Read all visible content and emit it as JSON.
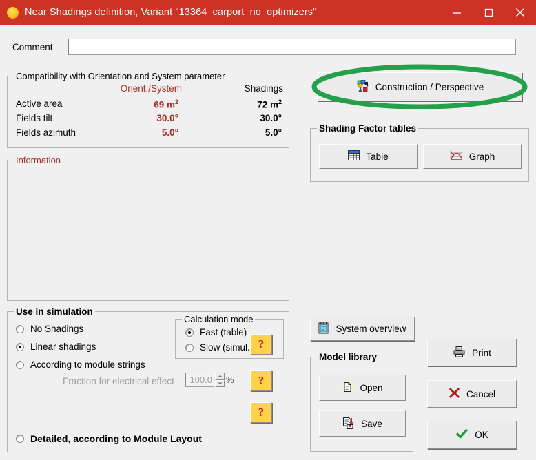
{
  "titlebar": {
    "icon": "sun-icon",
    "title": "Near Shadings definition, Variant \"13364_carport_no_optimizers\"",
    "minimize": "─",
    "maximize": "□",
    "close": "✕",
    "bg_color": "#cc3324",
    "text_color": "#ffffff"
  },
  "comment": {
    "label": "Comment",
    "value": "",
    "placeholder": ""
  },
  "compatibility": {
    "group_label": "Compatibility with Orientation and System parameter",
    "columns": [
      "",
      "Orient./System",
      "Shadings"
    ],
    "orient_color": "#a33028",
    "rows": [
      {
        "label": "Active area",
        "orient": "69 m",
        "orient_sup": "2",
        "shadings": "72 m",
        "shadings_sup": "2"
      },
      {
        "label": "Fields tilt",
        "orient": "30.0°",
        "orient_sup": "",
        "shadings": "30.0°",
        "shadings_sup": ""
      },
      {
        "label": "Fields azimuth",
        "orient": "5.0°",
        "orient_sup": "",
        "shadings": "5.0°",
        "shadings_sup": ""
      }
    ]
  },
  "information": {
    "group_label": "Information",
    "label_color": "#a33028",
    "content": ""
  },
  "use_in_simulation": {
    "group_label": "Use in simulation",
    "options": [
      {
        "label": "No Shadings",
        "selected": false,
        "bold": false
      },
      {
        "label": "Linear shadings",
        "selected": true,
        "bold": false
      },
      {
        "label": "According to module strings",
        "selected": false,
        "bold": false
      },
      {
        "label": "Detailed, according to Module Layout",
        "selected": false,
        "bold": true
      }
    ],
    "fraction": {
      "label": "Fraction for electrical effect",
      "value": "100.0",
      "unit": "%",
      "enabled": false
    },
    "calculation_mode": {
      "group_label": "Calculation mode",
      "options": [
        {
          "label": "Fast (table)",
          "selected": true
        },
        {
          "label": "Slow (simul.)",
          "selected": false
        }
      ]
    },
    "help_buttons": [
      {
        "name": "help-calc-mode",
        "glyph": "?"
      },
      {
        "name": "help-fraction",
        "glyph": "?"
      },
      {
        "name": "help-module-layout",
        "glyph": "?"
      }
    ]
  },
  "construction": {
    "label": "Construction / Perspective",
    "icon": "shapes-3d-icon",
    "highlight_color": "#22a04a",
    "highlighted": true
  },
  "shading_factor_tables": {
    "group_label": "Shading Factor tables",
    "buttons": [
      {
        "label": "Table",
        "icon": "grid-table-icon"
      },
      {
        "label": "Graph",
        "icon": "line-chart-icon"
      }
    ]
  },
  "system_overview": {
    "label": "System overview",
    "icon": "notepad-icon"
  },
  "model_library": {
    "group_label": "Model library",
    "buttons": [
      {
        "label": "Open",
        "icon": "open-document-icon"
      },
      {
        "label": "Save",
        "icon": "save-disk-icon"
      }
    ]
  },
  "actions": [
    {
      "label": "Print",
      "icon": "printer-icon"
    },
    {
      "label": "Cancel",
      "icon": "red-x-icon"
    },
    {
      "label": "OK",
      "icon": "green-check-icon"
    }
  ],
  "theme": {
    "background": "#f0f0f0",
    "accent_red": "#a33028",
    "annotation_green": "#22a04a"
  }
}
